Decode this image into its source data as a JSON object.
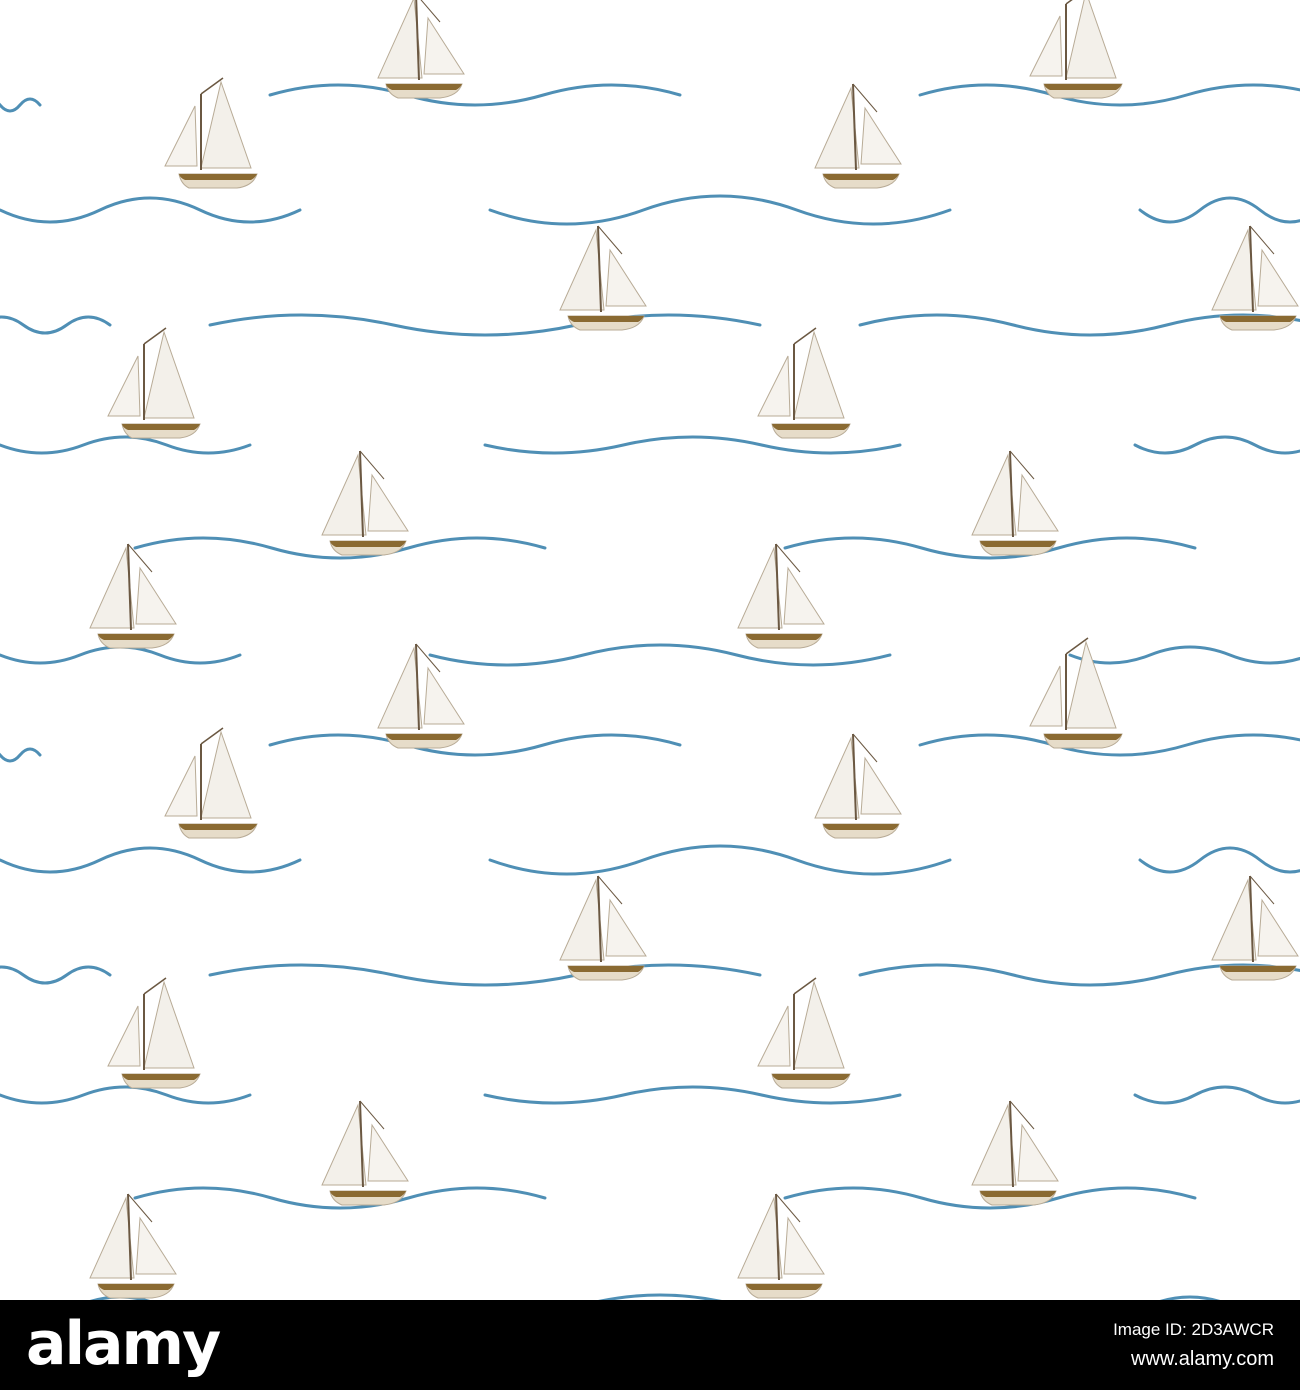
{
  "pattern": {
    "description_colors": {
      "background": "#ffffff",
      "wave": "#4f8fb5",
      "sail": "#f3f0ea",
      "sail_outline": "#b8ab96",
      "mast": "#6b5842",
      "hull_top": "#8a6a32",
      "hull_bottom": "#e6dcc9"
    }
  },
  "footer": {
    "logo_text": "alamy",
    "image_id": "Image ID: 2D3AWCR",
    "url": "www.alamy.com"
  }
}
